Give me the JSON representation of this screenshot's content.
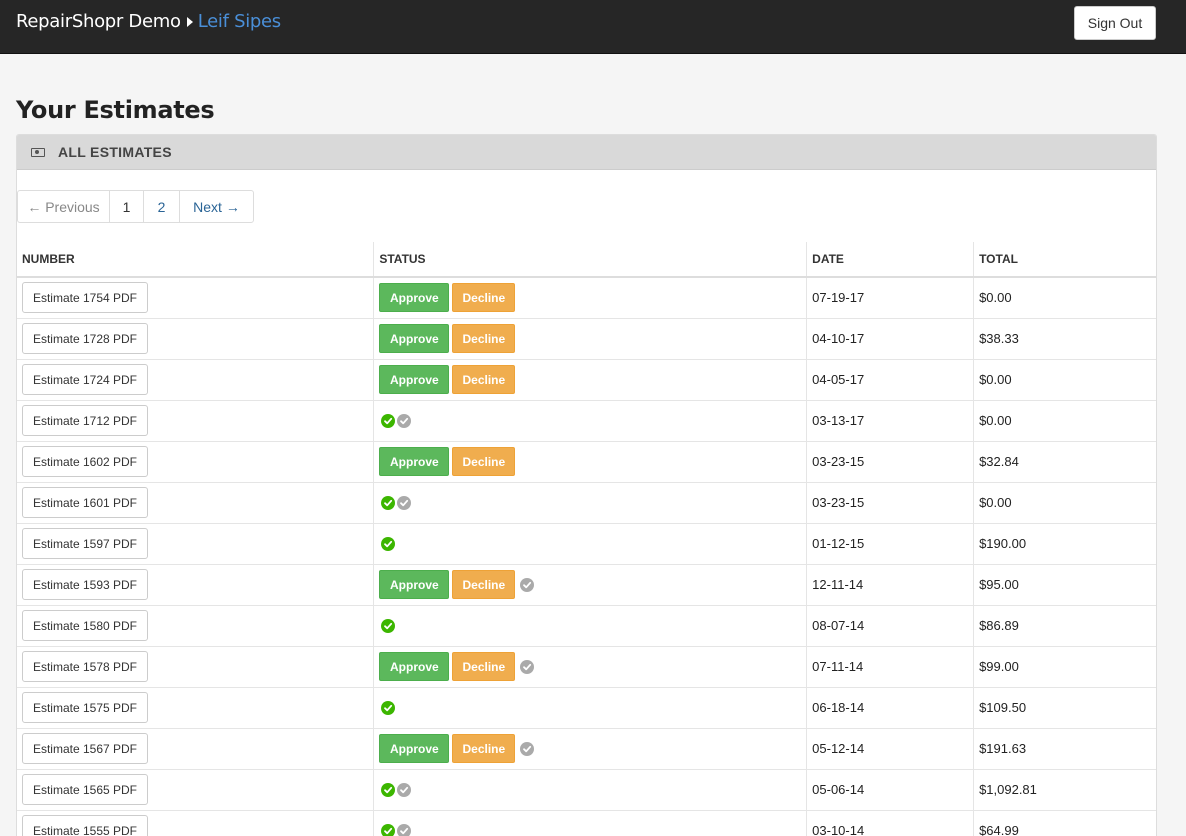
{
  "header": {
    "brand": "RepairShopr Demo",
    "user": "Leif Sipes",
    "signout_label": "Sign Out"
  },
  "page_title": "Your Estimates",
  "panel": {
    "title": "ALL ESTIMATES",
    "icon": "money-icon"
  },
  "pagination": {
    "prev": "← Previous",
    "pages": [
      "1",
      "2"
    ],
    "next": "Next →",
    "current": "1"
  },
  "table": {
    "headers": [
      "NUMBER",
      "STATUS",
      "DATE",
      "TOTAL"
    ],
    "rows": [
      {
        "number": "Estimate 1754 PDF",
        "status": "actions",
        "date": "07-19-17",
        "total": "$0.00"
      },
      {
        "number": "Estimate 1728 PDF",
        "status": "actions",
        "date": "04-10-17",
        "total": "$38.33"
      },
      {
        "number": "Estimate 1724 PDF",
        "status": "actions",
        "date": "04-05-17",
        "total": "$0.00"
      },
      {
        "number": "Estimate 1712 PDF",
        "status": "approved-sent",
        "date": "03-13-17",
        "total": "$0.00"
      },
      {
        "number": "Estimate 1602 PDF",
        "status": "actions",
        "date": "03-23-15",
        "total": "$32.84"
      },
      {
        "number": "Estimate 1601 PDF",
        "status": "approved-sent",
        "date": "03-23-15",
        "total": "$0.00"
      },
      {
        "number": "Estimate 1597 PDF",
        "status": "approved",
        "date": "01-12-15",
        "total": "$190.00"
      },
      {
        "number": "Estimate 1593 PDF",
        "status": "actions-sent",
        "date": "12-11-14",
        "total": "$95.00"
      },
      {
        "number": "Estimate 1580 PDF",
        "status": "approved",
        "date": "08-07-14",
        "total": "$86.89"
      },
      {
        "number": "Estimate 1578 PDF",
        "status": "actions-sent",
        "date": "07-11-14",
        "total": "$99.00"
      },
      {
        "number": "Estimate 1575 PDF",
        "status": "approved",
        "date": "06-18-14",
        "total": "$109.50"
      },
      {
        "number": "Estimate 1567 PDF",
        "status": "actions-sent",
        "date": "05-12-14",
        "total": "$191.63"
      },
      {
        "number": "Estimate 1565 PDF",
        "status": "approved-sent",
        "date": "05-06-14",
        "total": "$1,092.81"
      },
      {
        "number": "Estimate 1555 PDF",
        "status": "approved-sent",
        "date": "03-10-14",
        "total": "$64.99"
      }
    ],
    "approve_label": "Approve",
    "decline_label": "Decline"
  },
  "colors": {
    "topbar": "#262626",
    "link": "#4a8fd8",
    "approve": "#5cb85c",
    "decline": "#f0ad4e",
    "check_green": "#3cb600",
    "check_grey": "#aaaaaa"
  }
}
